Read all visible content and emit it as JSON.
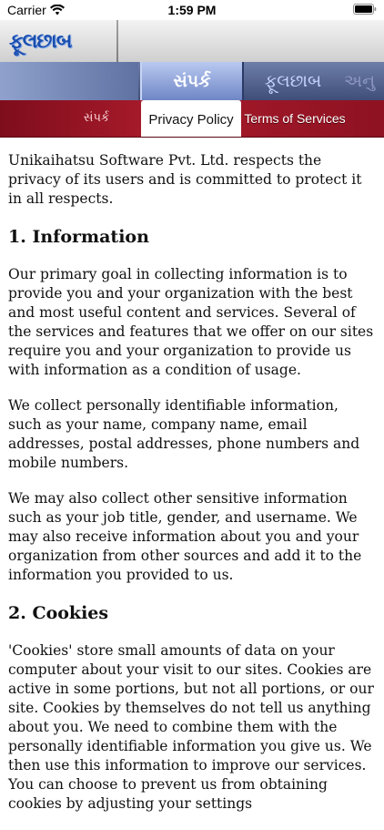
{
  "status_bar": {
    "carrier": "Carrier",
    "time": "1:59 PM"
  },
  "header": {
    "logo_text": "ફૂલછાબ"
  },
  "tabs": [
    {
      "label": "સંપર્ક",
      "active": true
    },
    {
      "label": "ફૂલછાબ",
      "active": false
    },
    {
      "label": "અનુ",
      "active": false
    }
  ],
  "sub_nav": [
    {
      "label": "સંપર્ક",
      "active": false
    },
    {
      "label": "Privacy Policy",
      "active": true
    },
    {
      "label": "Terms of Services",
      "active": false
    }
  ],
  "content": {
    "intro": "Unikaihatsu Software Pvt. Ltd. respects the privacy of its users and is committed to protect it in all respects.",
    "sections": [
      {
        "heading": "1. Information",
        "paragraphs": [
          "Our primary goal in collecting information is to provide you and your organization with the best and most useful content and services. Several of the services and features that we offer on our sites require you and your organization to provide us with information as a condition of usage.",
          "We collect personally identifiable information, such as your name, company name, email addresses, postal addresses, phone numbers and mobile numbers.",
          "We may also collect other sensitive information such as your job title, gender, and username. We may also receive information about you and your organization from other sources and add it to the information you provided to us."
        ]
      },
      {
        "heading": "2. Cookies",
        "paragraphs": [
          "'Cookies' store small amounts of data on your computer about your visit to our sites. Cookies are active in some portions, but not all portions, or our site. Cookies by themselves do not tell us anything about you. We need to combine them with the personally identifiable information you give us. We then use this information to improve our services. You can choose to prevent us from obtaining cookies by adjusting your settings"
        ]
      }
    ]
  }
}
